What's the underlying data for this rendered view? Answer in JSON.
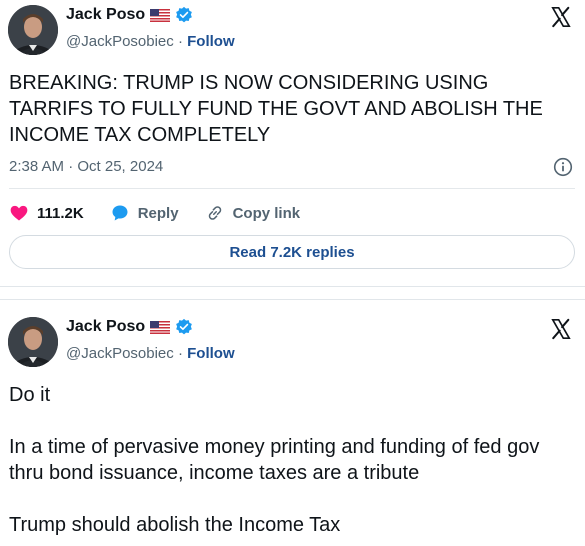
{
  "colors": {
    "link_blue": "#1d4f91",
    "verified_blue": "#1d9bf0",
    "like_pink": "#f91880",
    "secondary_text": "#536471",
    "primary_text": "#0f1419"
  },
  "tweets": [
    {
      "author": {
        "display_name": "Jack Poso",
        "handle": "@JackPosobiec",
        "flag_icon": "us-flag-icon",
        "verified_icon": "verified-badge-icon"
      },
      "follow_label": "Follow",
      "handle_separator": " · ",
      "text": "BREAKING: TRUMP IS NOW CONSIDERING USING TARRIFS TO FULLY FUND THE GOVT AND ABOLISH THE INCOME TAX COMPLETELY",
      "timestamp": "2:38 AM · Oct 25, 2024",
      "actions": {
        "likes": "111.2K",
        "reply_label": "Reply",
        "copy_link_label": "Copy link"
      },
      "read_replies_label": "Read 7.2K replies"
    },
    {
      "author": {
        "display_name": "Jack Poso",
        "handle": "@JackPosobiec",
        "flag_icon": "us-flag-icon",
        "verified_icon": "verified-badge-icon"
      },
      "follow_label": "Follow",
      "handle_separator": " · ",
      "text": "Do it\n\nIn a time of pervasive money printing and funding of fed gov thru bond issuance, income taxes are a tribute\n\nTrump should abolish the Income Tax"
    }
  ]
}
